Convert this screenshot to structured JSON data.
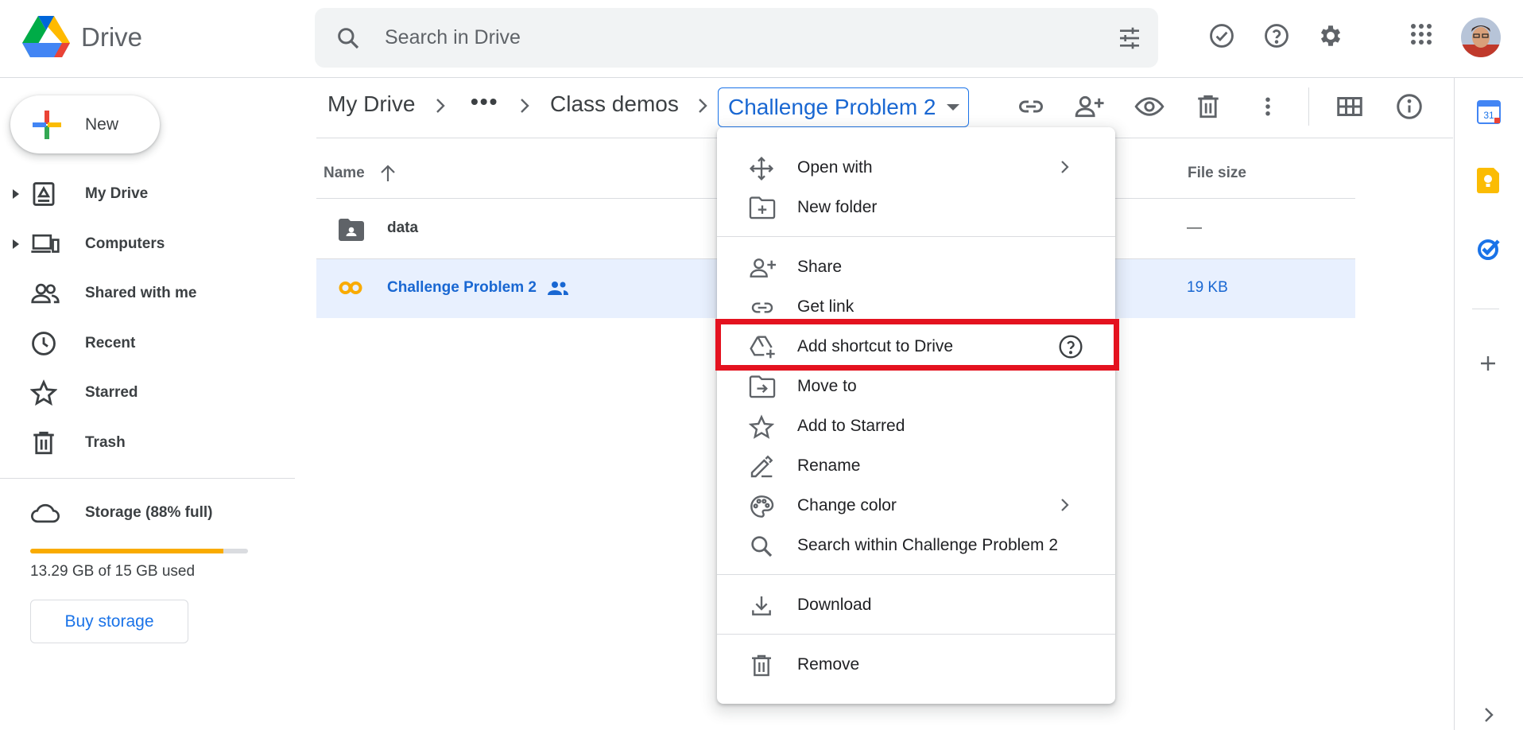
{
  "app": {
    "name": "Drive"
  },
  "search": {
    "placeholder": "Search in Drive"
  },
  "sidebar": {
    "new_label": "New",
    "items": [
      {
        "label": "My Drive"
      },
      {
        "label": "Computers"
      },
      {
        "label": "Shared with me"
      },
      {
        "label": "Recent"
      },
      {
        "label": "Starred"
      },
      {
        "label": "Trash"
      }
    ],
    "storage": {
      "label": "Storage (88% full)",
      "used_text": "13.29 GB of 15 GB used",
      "fraction": 0.886,
      "buy_label": "Buy storage"
    }
  },
  "breadcrumb": {
    "root": "My Drive",
    "more": "•••",
    "parent": "Class demos",
    "current": "Challenge Problem 2"
  },
  "list": {
    "headers": {
      "name": "Name",
      "size": "File size"
    },
    "rows": [
      {
        "name": "data",
        "size": "—"
      },
      {
        "name": "Challenge Problem 2",
        "size": "19 KB"
      }
    ]
  },
  "menu": {
    "items": [
      {
        "label": "Open with"
      },
      {
        "label": "New folder"
      },
      {
        "label": "Share"
      },
      {
        "label": "Get link"
      },
      {
        "label": "Add shortcut to Drive"
      },
      {
        "label": "Move to"
      },
      {
        "label": "Add to Starred"
      },
      {
        "label": "Rename"
      },
      {
        "label": "Change color"
      },
      {
        "label": "Search within Challenge Problem 2"
      },
      {
        "label": "Download"
      },
      {
        "label": "Remove"
      }
    ]
  },
  "rail": {
    "calendar_day": "31"
  },
  "colors": {
    "accent": "#1a73e8",
    "highlight": "#e4121f",
    "storage": "#f9ab00"
  }
}
